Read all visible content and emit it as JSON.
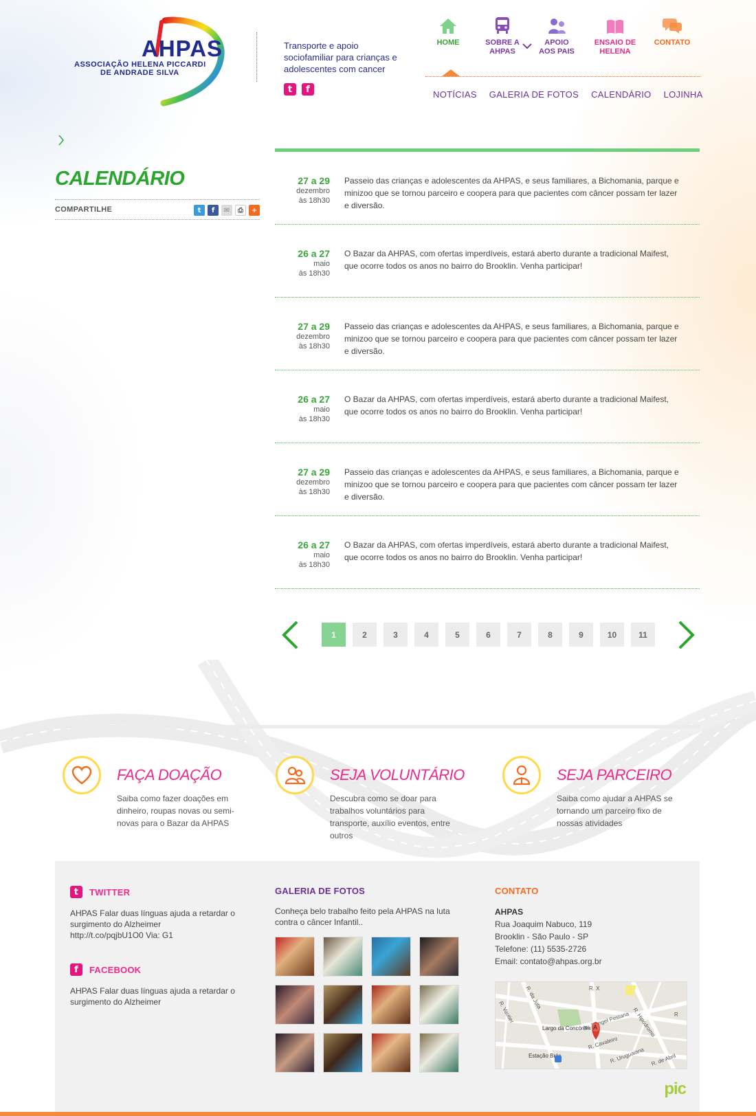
{
  "brand": {
    "logo_text": "AHPAS",
    "org_line1": "ASSOCIAÇÃO HELENA PICCARDI",
    "org_line2": "DE ANDRADE SILVA",
    "tagline": "Transporte e apoio sociofamiliar para crianças e adolescentes com cancer"
  },
  "nav": {
    "home": "HOME",
    "sobre": "SOBRE A AHPAS",
    "apoio": "APOIO AOS PAIS",
    "ensaio": "ENSAIO DE HELENA",
    "contato": "CONTATO"
  },
  "subnav": [
    "NOTÍCIAS",
    "GALERIA DE FOTOS",
    "CALENDÁRIO",
    "LOJINHA"
  ],
  "page": {
    "title": "CALENDÁRIO",
    "share_label": "COMPARTILHE"
  },
  "events": [
    {
      "range": "27 a 29",
      "month": "dezembro",
      "time": "às 18h30",
      "text": "Passeio das crianças e adolescentes da AHPAS, e seus familiares, a Bichomania, parque e minizoo que se tornou parceiro e coopera para que pacientes com câncer possam ter lazer e diversão."
    },
    {
      "range": "26 a 27",
      "month": "maio",
      "time": "às 18h30",
      "text": "O Bazar da AHPAS, com ofertas imperdíveis, estará aberto durante a tradicional Maifest, que ocorre todos os anos no bairro do Brooklin. Venha participar!"
    },
    {
      "range": "27 a 29",
      "month": "dezembro",
      "time": "às 18h30",
      "text": "Passeio das crianças e adolescentes da AHPAS, e seus familiares, a Bichomania, parque e minizoo que se tornou parceiro e coopera para que pacientes com câncer possam ter lazer e diversão."
    },
    {
      "range": "26 a 27",
      "month": "maio",
      "time": "às 18h30",
      "text": "O Bazar da AHPAS, com ofertas imperdíveis, estará aberto durante a tradicional Maifest, que ocorre todos os anos no bairro do Brooklin. Venha participar!"
    },
    {
      "range": "27 a 29",
      "month": "dezembro",
      "time": "às 18h30",
      "text": "Passeio das crianças e adolescentes da AHPAS, e seus familiares, a Bichomania, parque e minizoo que se tornou parceiro e coopera para que pacientes com câncer possam ter lazer e diversão."
    },
    {
      "range": "26 a 27",
      "month": "maio",
      "time": "às 18h30",
      "text": "O Bazar da AHPAS, com ofertas imperdíveis, estará aberto durante a tradicional Maifest, que ocorre todos os anos no bairro do Brooklin. Venha participar!"
    }
  ],
  "pagination": {
    "pages": [
      "1",
      "2",
      "3",
      "4",
      "5",
      "6",
      "7",
      "8",
      "9",
      "10",
      "11"
    ],
    "current": "1"
  },
  "cta": [
    {
      "title": "FAÇA DOAÇÃO",
      "text": "Saiba como fazer doações em dinheiro, roupas novas ou semi-novas para o Bazar da AHPAS",
      "icon": "heart-icon"
    },
    {
      "title": "SEJA VOLUNTÁRIO",
      "text": "Descubra como se doar para trabalhos voluntários para transporte, auxílio eventos, entre outros",
      "icon": "people-icon"
    },
    {
      "title": "SEJA PARCEIRO",
      "text": "Saiba como ajudar a AHPAS se tornando um parceiro fixo de nossas atividades",
      "icon": "person-icon"
    }
  ],
  "footer": {
    "twitter": {
      "title": "TWITTER",
      "text": "AHPAS Falar duas línguas ajuda a retardar o surgimento do Alzheimer http://t.co/pqjbU1O0 Via: G1"
    },
    "facebook": {
      "title": "FACEBOOK",
      "text": "AHPAS Falar duas línguas ajuda a retardar o surgimento do Alzheimer"
    },
    "gallery": {
      "title": "GALERIA DE FOTOS",
      "text": "Conheça belo trabalho feito pela AHPAS na luta contra o câncer Infantil.."
    },
    "contact": {
      "title": "CONTATO",
      "org": "AHPAS",
      "address": "Rua Joaquim Nabuco, 119",
      "city": "Brooklin - São Paulo - SP",
      "phone": "Telefone: (11) 5535-2726",
      "email": "Email: contato@ahpas.org.br"
    },
    "map_labels": {
      "largo": "Largo da Concórdia",
      "estacao": "Estação Brás",
      "marker": "A",
      "r_juta": "R. da Juta",
      "r_vautier": "R. Vautier",
      "r_hipodromo": "R. Hipódromo",
      "r_uruguaiana": "R. Uruguaiana",
      "av_rangel": "Av. Rangel Pestana",
      "r_cavaleiro": "R. Cavaleiro",
      "r_abril": "R. de Abril",
      "r_x": "R. X",
      "r_r": "R"
    },
    "credit": "pic"
  },
  "colors": {
    "green": "#3aa53a",
    "purple": "#6a3296",
    "pink": "#ec2b8c",
    "orange": "#f36b21",
    "yellow": "#ffd94a"
  }
}
